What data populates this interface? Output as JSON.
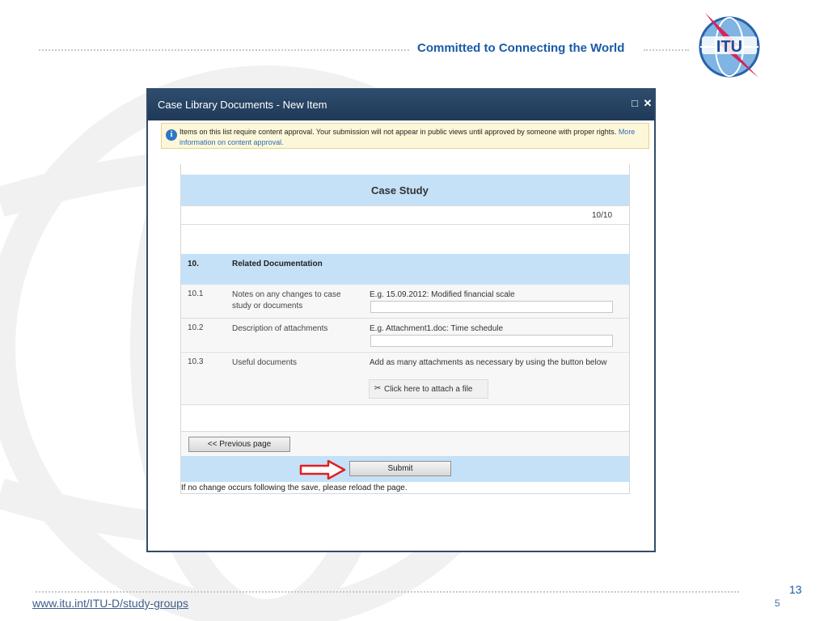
{
  "header": {
    "tagline": "Committed to Connecting the World",
    "logo_text": "ITU"
  },
  "footer": {
    "url": "www.itu.int/ITU-D/study-groups",
    "page_number": "13",
    "ghost_number": "5"
  },
  "dialog": {
    "title": "Case Library Documents - New Item",
    "maximize_icon": "maximize-icon",
    "close_icon": "close-icon",
    "notice": {
      "text": "Items on this list require content approval. Your submission will not appear in public views until approved by someone with proper rights.",
      "link": "More information on content approval."
    },
    "form": {
      "title": "Case Study",
      "pager": "10/10",
      "section": {
        "number": "10.",
        "title": "Related Documentation"
      },
      "fields": [
        {
          "number": "10.1",
          "label": "Notes on any changes to case study or documents",
          "hint": "E.g. 15.09.2012: Modified financial scale",
          "value": ""
        },
        {
          "number": "10.2",
          "label": "Description of attachments",
          "hint": "E.g. Attachment1.doc: Time schedule",
          "value": ""
        },
        {
          "number": "10.3",
          "label": "Useful documents",
          "hint": "Add as many attachments as necessary by using the button below",
          "attach_label": "Click here to attach a file"
        }
      ],
      "previous_label": "<< Previous page",
      "submit_label": "Submit",
      "reload_note": "If no change occurs following the save, please reload the page."
    }
  },
  "colors": {
    "accent": "#1b5aa7",
    "title_bar": "#2e4d6e",
    "section_band": "#c4e1f8",
    "arrow": "#e02020"
  }
}
